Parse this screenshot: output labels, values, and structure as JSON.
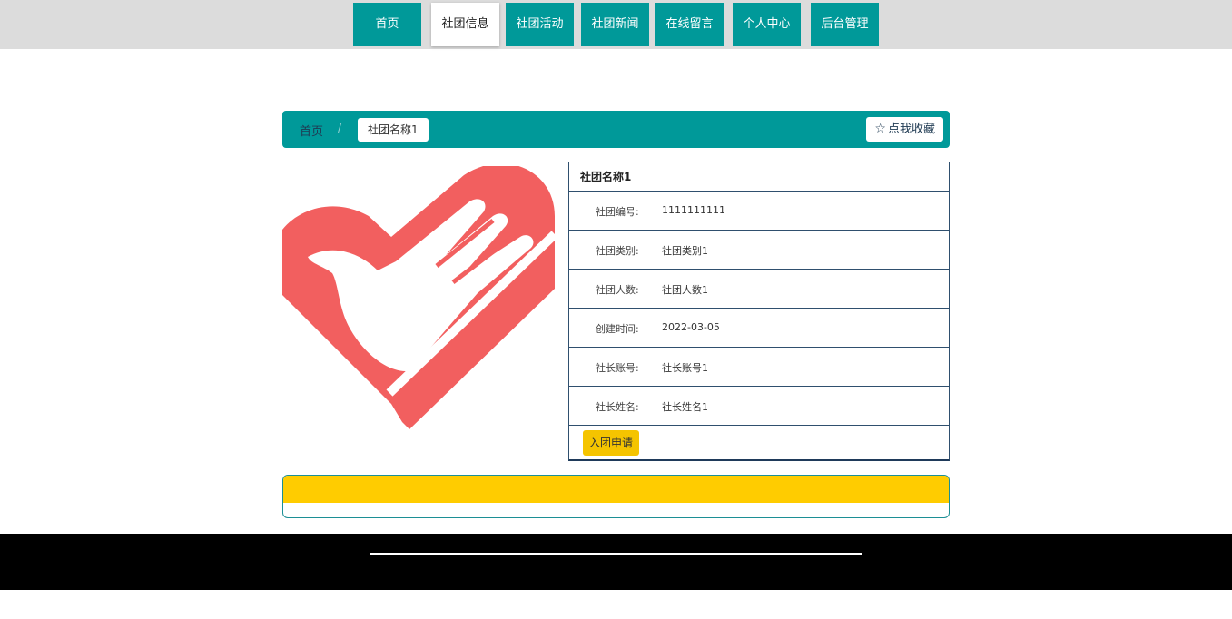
{
  "nav": {
    "items": [
      {
        "label": "首页"
      },
      {
        "label": "社团信息"
      },
      {
        "label": "社团活动"
      },
      {
        "label": "社团新闻"
      },
      {
        "label": "在线留言"
      },
      {
        "label": "个人中心"
      },
      {
        "label": "后台管理"
      }
    ],
    "active_index": 1,
    "accent_color": "#009999"
  },
  "breadcrumb": {
    "home": "首页",
    "separator": "/",
    "current": "社团名称1"
  },
  "favorite": {
    "icon": "star-icon",
    "star": "☆",
    "label": "点我收藏"
  },
  "logo": {
    "icon": "heart-hand-dove-logo",
    "color": "#f25f5f"
  },
  "club": {
    "title": "社团名称1",
    "fields": [
      {
        "label": "社团编号:",
        "value": "1111111111"
      },
      {
        "label": "社团类别:",
        "value": "社团类别1"
      },
      {
        "label": "社团人数:",
        "value": "社团人数1"
      },
      {
        "label": "创建时间:",
        "value": "2022-03-05"
      },
      {
        "label": "社长账号:",
        "value": "社长账号1"
      },
      {
        "label": "社长姓名:",
        "value": "社长姓名1"
      }
    ],
    "join_label": "入团申请"
  },
  "colors": {
    "teal": "#009999",
    "yellow": "#ffcc00",
    "footer": "#000000"
  }
}
